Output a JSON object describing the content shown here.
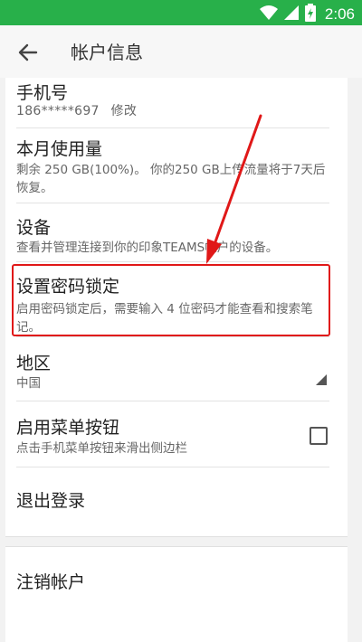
{
  "status": {
    "time": "2:06"
  },
  "appbar": {
    "title": "帐户信息"
  },
  "items": {
    "phone": {
      "label": "手机号",
      "sub": "186*****697",
      "action": "修改"
    },
    "usage": {
      "label": "本月使用量",
      "sub": "剩余 250 GB(100%)。 你的250 GB上传流量将于7天后恢复。"
    },
    "devices": {
      "label": "设备",
      "sub": "查看并管理连接到你的印象TEAMS帐户的设备。"
    },
    "passcode": {
      "label": "设置密码锁定",
      "sub": "启用密码锁定后，需要输入 4 位密码才能查看和搜索笔记。"
    },
    "region": {
      "label": "地区",
      "sub": "中国"
    },
    "menu_button": {
      "label": "启用菜单按钮",
      "sub": "点击手机菜单按钮来滑出侧边栏",
      "checked": false
    },
    "logout": {
      "label": "退出登录"
    }
  },
  "delete_account": {
    "label": "注销帐户"
  },
  "colors": {
    "statusbar": "#28b04a",
    "highlight": "#e01818"
  }
}
